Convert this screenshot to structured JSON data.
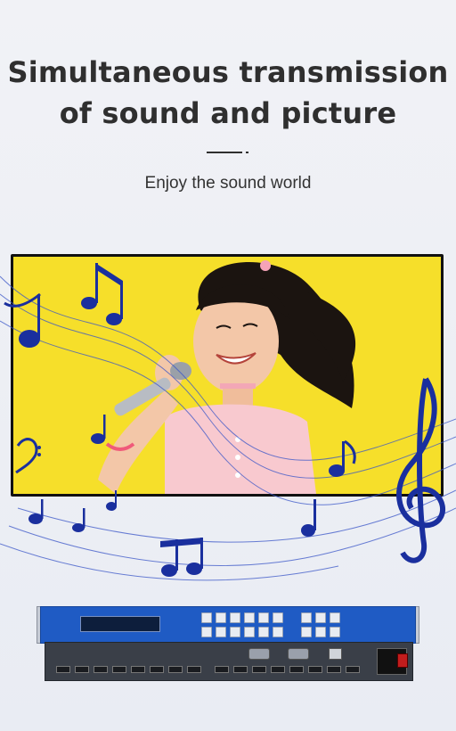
{
  "heading": {
    "line1": "Simultaneous transmission",
    "line2": "of sound and picture"
  },
  "subtitle": "Enjoy the sound world",
  "icons": {
    "note_color": "#1a2f9e",
    "accent_blue": "#1f5bc4"
  }
}
